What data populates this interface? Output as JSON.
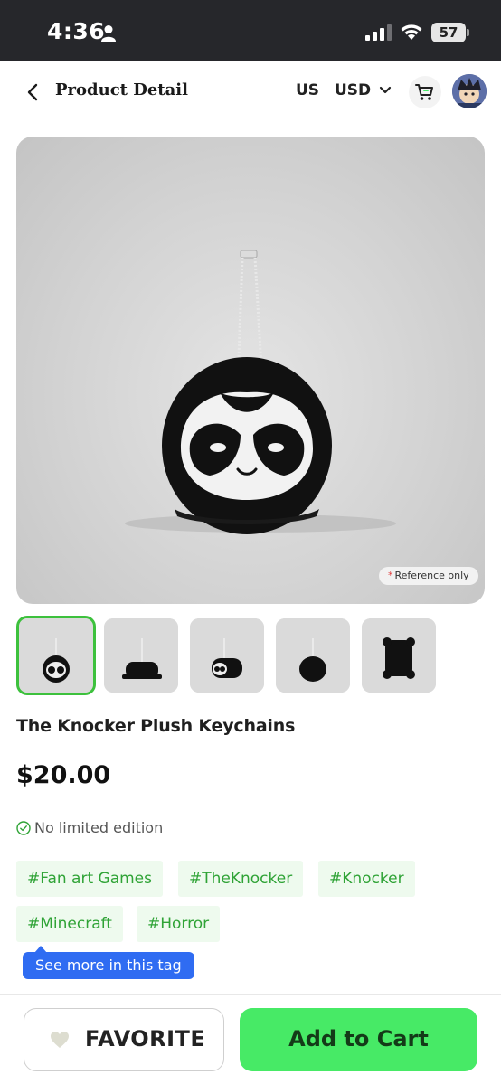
{
  "status_bar": {
    "time": "4:36",
    "battery": "57"
  },
  "header": {
    "title": "Product Detail",
    "region": "US",
    "currency": "USD"
  },
  "product": {
    "reference_note": "Reference only",
    "title": "The Knocker Plush Keychains",
    "price": "$20.00",
    "edition": "No limited edition",
    "tags": [
      "#Fan art Games",
      "#TheKnocker",
      "#Knocker",
      "#Minecraft",
      "#Horror"
    ],
    "tag_tooltip": "See more in this tag",
    "thumbnail_count": 5
  },
  "actions": {
    "favorite_label": "FAVORITE",
    "add_to_cart_label": "Add to Cart"
  },
  "colors": {
    "accent_green": "#47ea66",
    "tag_green": "#2fa336",
    "tooltip_blue": "#2f6cf2",
    "status_bar_bg": "#26272b"
  }
}
